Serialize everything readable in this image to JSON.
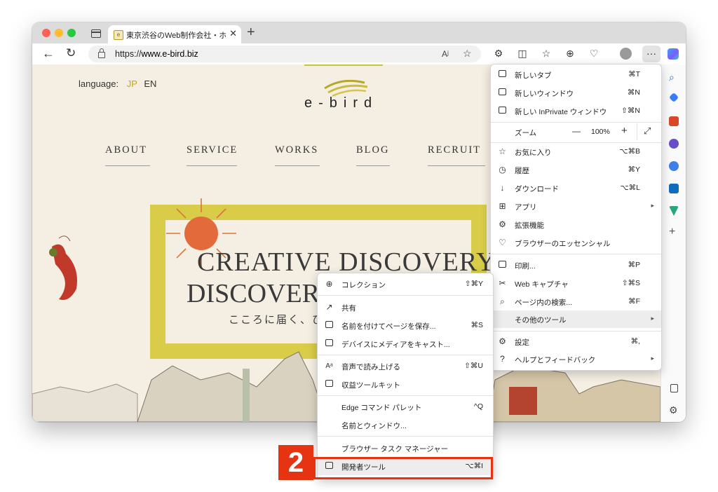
{
  "browser": {
    "tab_title": "東京渋谷のWeb制作会社・ホーム",
    "tab_favicon": "e",
    "url_prefix": "https://",
    "url_host": "www.e-bird.biz"
  },
  "site": {
    "language_label": "language:",
    "lang_jp": "JP",
    "lang_en": "EN",
    "logo": "e-bird",
    "nav": [
      "ABOUT",
      "SERVICE",
      "WORKS",
      "BLOG",
      "RECRUIT"
    ],
    "hero_line1": "CREATIVE DISCOVERY",
    "hero_line2": "DISCOVER",
    "hero_line3": "こころに届く、ひ"
  },
  "main_menu": {
    "items": [
      {
        "icon": "new-tab-icon",
        "label": "新しいタブ",
        "shortcut": "⌘T"
      },
      {
        "icon": "new-window-icon",
        "label": "新しいウィンドウ",
        "shortcut": "⌘N"
      },
      {
        "icon": "inprivate-icon",
        "label": "新しい InPrivate ウィンドウ",
        "shortcut": "⇧⌘N"
      }
    ],
    "zoom": {
      "label": "ズーム",
      "minus": "—",
      "value": "100%",
      "plus": "+",
      "fullscreen": "⤢"
    },
    "items2": [
      {
        "icon": "favorites-icon",
        "label": "お気に入り",
        "shortcut": "⌥⌘B"
      },
      {
        "icon": "history-icon",
        "label": "履歴",
        "shortcut": "⌘Y"
      },
      {
        "icon": "download-icon",
        "label": "ダウンロード",
        "shortcut": "⌥⌘L"
      },
      {
        "icon": "apps-icon",
        "label": "アプリ",
        "shortcut": "▸"
      },
      {
        "icon": "extensions-icon",
        "label": "拡張機能",
        "shortcut": ""
      },
      {
        "icon": "browser-essentials-icon",
        "label": "ブラウザーのエッセンシャル",
        "shortcut": ""
      }
    ],
    "items3": [
      {
        "icon": "print-icon",
        "label": "印刷...",
        "shortcut": "⌘P"
      },
      {
        "icon": "web-capture-icon",
        "label": "Web キャプチャ",
        "shortcut": "⇧⌘S"
      },
      {
        "icon": "find-icon",
        "label": "ページ内の検索...",
        "shortcut": "⌘F"
      },
      {
        "icon": "",
        "label": "その他のツール",
        "shortcut": "▸"
      }
    ],
    "items4": [
      {
        "icon": "settings-icon",
        "label": "設定",
        "shortcut": "⌘,"
      },
      {
        "icon": "help-icon",
        "label": "ヘルプとフィードバック",
        "shortcut": "▸"
      }
    ]
  },
  "sub_menu": {
    "items": [
      {
        "icon": "collections-icon",
        "label": "コレクション",
        "shortcut": "⇧⌘Y"
      },
      {
        "icon": "share-icon",
        "label": "共有",
        "shortcut": ""
      },
      {
        "icon": "save-page-icon",
        "label": "名前を付けてページを保存...",
        "shortcut": "⌘S"
      },
      {
        "icon": "cast-icon",
        "label": "デバイスにメディアをキャスト...",
        "shortcut": ""
      },
      {
        "icon": "read-aloud-icon",
        "label": "音声で読み上げる",
        "shortcut": "⇧⌘U"
      },
      {
        "icon": "revenue-toolkit-icon",
        "label": "収益ツールキット",
        "shortcut": ""
      },
      {
        "icon": "",
        "label": "Edge コマンド パレット",
        "shortcut": "^Q"
      },
      {
        "icon": "",
        "label": "名前とウィンドウ...",
        "shortcut": ""
      },
      {
        "icon": "",
        "label": "ブラウザー タスク マネージャー",
        "shortcut": ""
      },
      {
        "icon": "devtools-icon",
        "label": "開発者ツール",
        "shortcut": "⌥⌘I"
      }
    ]
  },
  "annotation": {
    "step": "2",
    "color": "#e63312"
  },
  "colors": {
    "accent": "#d8cc49",
    "menu_highlight": "#ededed",
    "page_bg": "#f5efe3"
  }
}
